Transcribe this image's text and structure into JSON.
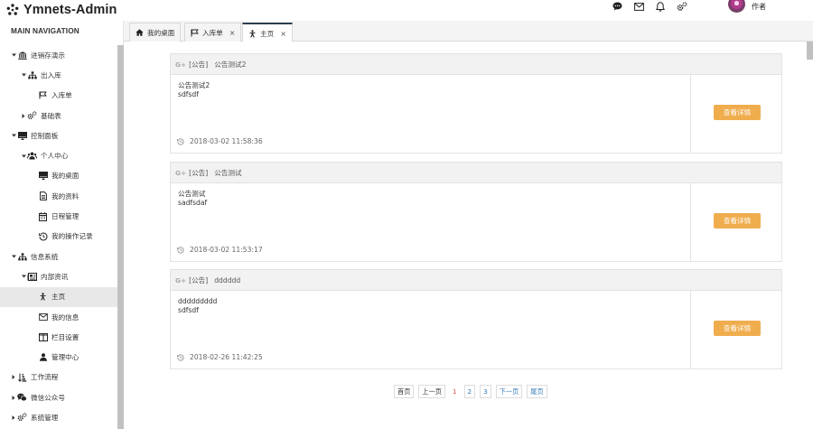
{
  "app": {
    "brand": "Ymnets-Admin"
  },
  "header": {
    "tools": [
      {
        "name": "message-icon"
      },
      {
        "name": "mail-icon"
      },
      {
        "name": "bell-icon"
      },
      {
        "name": "gears-icon"
      }
    ],
    "user_name": "作者"
  },
  "sidebar": {
    "heading": "MAIN NAVIGATION",
    "items": [
      {
        "label": "进销存演示",
        "level": 0,
        "caret": "down",
        "icon": "bank-icon"
      },
      {
        "label": "出入库",
        "level": 1,
        "caret": "down",
        "icon": "sitemap-icon"
      },
      {
        "label": "入库单",
        "level": 2,
        "caret": "",
        "icon": "flag-icon"
      },
      {
        "label": "基础表",
        "level": 1,
        "caret": "right",
        "icon": "gears-icon"
      },
      {
        "label": "控制面板",
        "level": 0,
        "caret": "down",
        "icon": "desktop-icon"
      },
      {
        "label": "个人中心",
        "level": 1,
        "caret": "down",
        "icon": "users-icon"
      },
      {
        "label": "我的桌面",
        "level": 2,
        "caret": "",
        "icon": "desktop-icon"
      },
      {
        "label": "我的资料",
        "level": 2,
        "caret": "",
        "icon": "file-icon"
      },
      {
        "label": "日程管理",
        "level": 2,
        "caret": "",
        "icon": "calendar-icon"
      },
      {
        "label": "我的操作记录",
        "level": 2,
        "caret": "",
        "icon": "history-icon"
      },
      {
        "label": "信息系统",
        "level": 0,
        "caret": "down",
        "icon": "sitemap-icon"
      },
      {
        "label": "内部资讯",
        "level": 1,
        "caret": "down",
        "icon": "newspaper-icon"
      },
      {
        "label": "主页",
        "level": 2,
        "caret": "",
        "icon": "child-icon",
        "active": true
      },
      {
        "label": "我的信息",
        "level": 2,
        "caret": "",
        "icon": "envelope-icon"
      },
      {
        "label": "栏目设置",
        "level": 2,
        "caret": "",
        "icon": "columns-icon"
      },
      {
        "label": "管理中心",
        "level": 2,
        "caret": "",
        "icon": "user-manage-icon"
      },
      {
        "label": "工作流程",
        "level": 0,
        "caret": "right",
        "icon": "sort-icon"
      },
      {
        "label": "微信公众号",
        "level": 0,
        "caret": "right",
        "icon": "wechat-icon"
      },
      {
        "label": "系统管理",
        "level": 0,
        "caret": "right",
        "icon": "gears-icon"
      }
    ]
  },
  "tabs": [
    {
      "label": "我的桌面",
      "icon": "home-icon",
      "closable": false
    },
    {
      "label": "入库单",
      "icon": "flag-icon",
      "closable": true,
      "close": "×"
    },
    {
      "label": "主页",
      "icon": "child-icon",
      "closable": true,
      "close": "×",
      "active": true
    }
  ],
  "notices": [
    {
      "tag": "[公告]",
      "title": "公告测试2",
      "body_lines": [
        "公告测试2",
        "sdfsdf"
      ],
      "time": "2018-03-02 11:58:36",
      "button": "查看详情"
    },
    {
      "tag": "[公告]",
      "title": "公告测试",
      "body_lines": [
        "公告测试",
        "sadfsdaf"
      ],
      "time": "2018-03-02 11:53:17",
      "button": "查看详情"
    },
    {
      "tag": "[公告]",
      "title": "dddddd",
      "body_lines": [
        "ddddddddd",
        "sdfsdf"
      ],
      "time": "2018-02-26 11:42:25",
      "button": "查看详情"
    }
  ],
  "notice_icon_text": "G+",
  "pagination": {
    "first": "首页",
    "prev": "上一页",
    "pages": [
      "1",
      "2",
      "3"
    ],
    "current": "1",
    "next": "下一页",
    "last": "尾页"
  },
  "colors": {
    "button": "#f0ad4e",
    "link": "#337ab7",
    "current_page": "#d9534f",
    "active_tab_border": "#2c3e50"
  }
}
